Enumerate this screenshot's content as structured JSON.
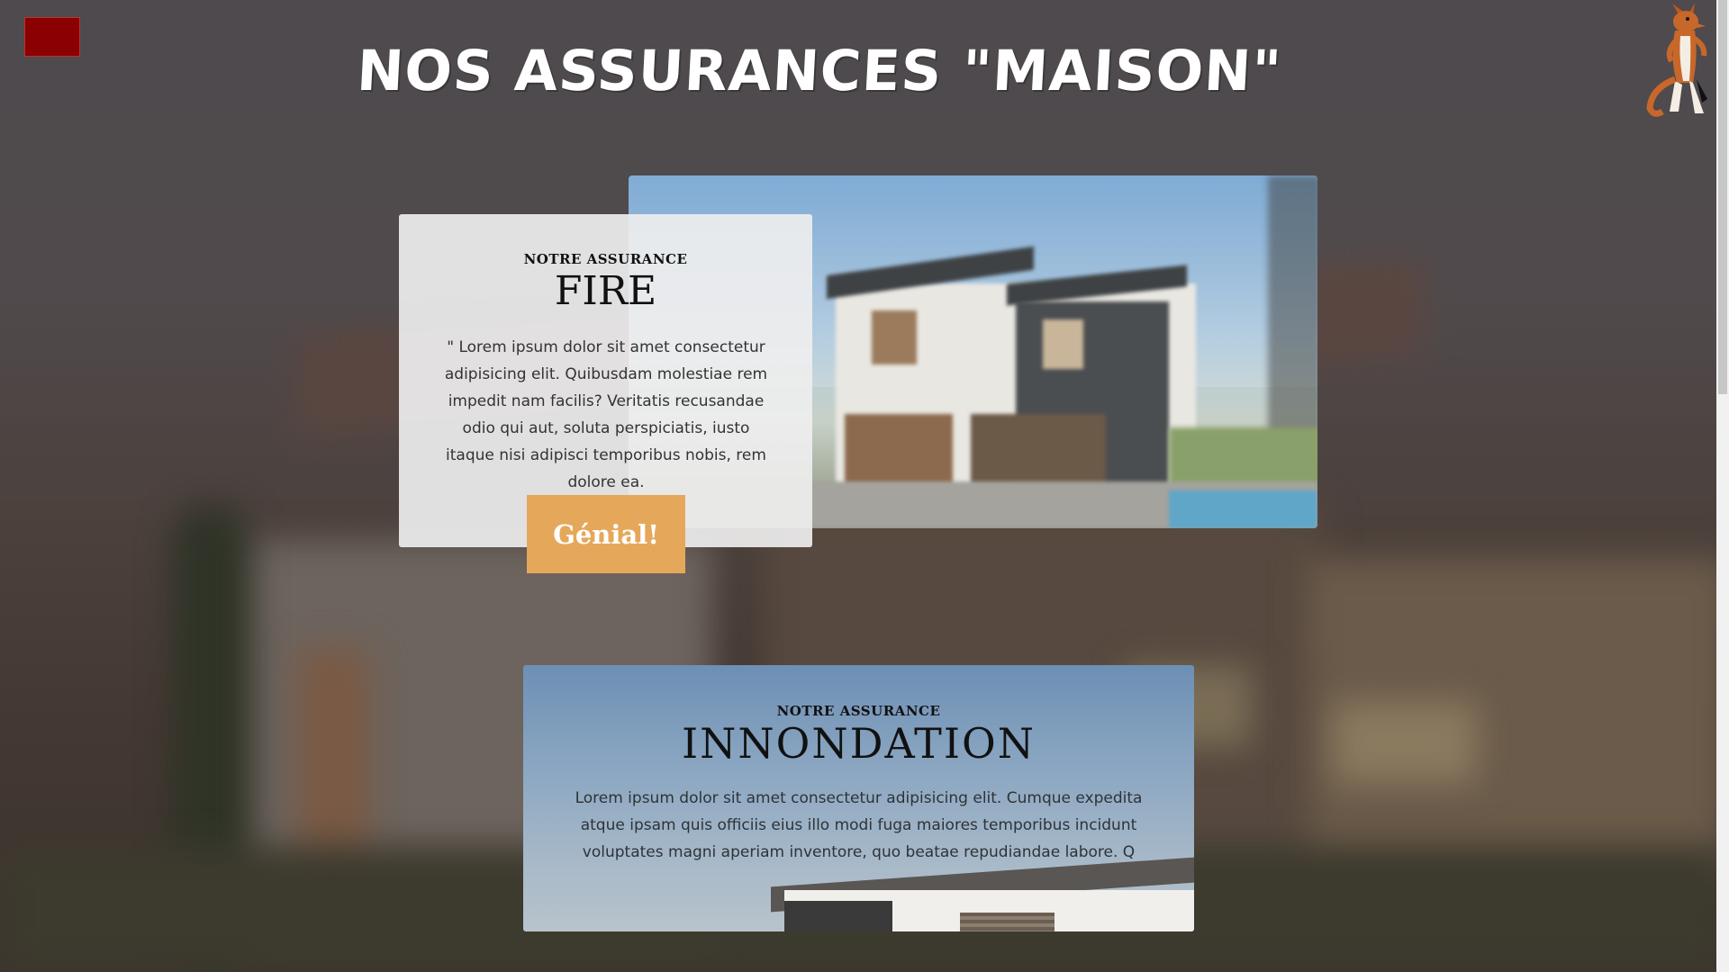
{
  "header": {
    "title": "NOS ASSURANCES \"MAISON\"",
    "menu_icon": "menu-icon",
    "mascot_icon": "fox-mascot-icon"
  },
  "cards": [
    {
      "eyebrow": "NOTRE ASSURANCE",
      "heading": "FIRE",
      "body": "\" Lorem ipsum dolor sit amet consectetur adipisicing elit. Quibusdam molestiae rem impedit nam facilis? Veritatis recusandae odio qui aut, soluta perspiciatis, iusto itaque nisi adipisci temporibus nobis, rem dolore ea.",
      "button_label": "Génial!"
    },
    {
      "eyebrow": "NOTRE ASSURANCE",
      "heading": "INNONDATION",
      "body": "Lorem ipsum dolor sit amet consectetur adipisicing elit. Cumque expedita atque ipsam quis officiis eius illo modi fuga maiores temporibus incidunt voluptates magni aperiam inventore, quo beatae repudiandae labore. Q"
    }
  ],
  "colors": {
    "menu_button": "#8b0000",
    "cta_button": "#e5a85a",
    "card_panel": "#eeeeee",
    "title_text": "#ffffff"
  }
}
